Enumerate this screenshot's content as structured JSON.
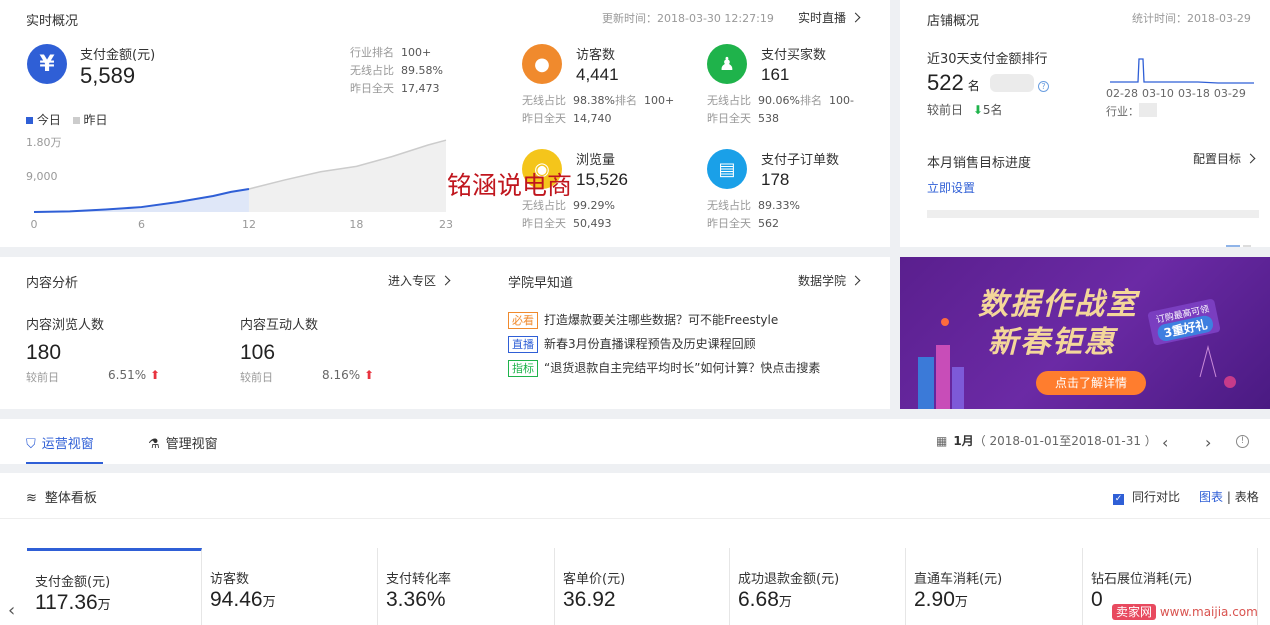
{
  "realtime": {
    "title": "实时概况",
    "update_time": "更新时间：2018-03-30 12:27:19",
    "live_link": "实时直播",
    "pay": {
      "label": "支付金额(元)",
      "value": "5,589",
      "rows": [
        {
          "k": "行业排名",
          "v": "100+"
        },
        {
          "k": "无线占比",
          "v": "89.58%"
        },
        {
          "k": "昨日全天",
          "v": "17,473"
        }
      ]
    },
    "legend_today": "今日",
    "legend_yesterday": "昨日",
    "chart": {
      "type": "area",
      "x_ticks": [
        "0",
        "6",
        "12",
        "18",
        "23"
      ],
      "y_ticks": [
        "1.80万",
        "9,000"
      ],
      "today_color": "#2f5fd6",
      "yesterday_color": "#cccccc",
      "series": [
        {
          "name": "今日",
          "x": [
            0,
            2,
            4,
            6,
            8,
            10,
            11,
            12
          ],
          "values": [
            0,
            150,
            600,
            1200,
            2400,
            3900,
            4900,
            5589
          ]
        },
        {
          "name": "昨日",
          "x": [
            0,
            2,
            4,
            6,
            8,
            10,
            12,
            14,
            16,
            18,
            20,
            22,
            23
          ],
          "values": [
            0,
            150,
            600,
            1200,
            2400,
            3900,
            5600,
            7800,
            9800,
            11100,
            13500,
            16300,
            17473
          ]
        }
      ],
      "ylim": [
        0,
        18000
      ]
    },
    "metrics": [
      {
        "name": "访客数",
        "value": "4,441",
        "r1k": "无线占比",
        "r1v": "98.38%",
        "r1k2": "排名",
        "r1v2": "100+",
        "r2k": "昨日全天",
        "r2v": "14,740",
        "icon": "footprint-icon",
        "color": "#f08a2d"
      },
      {
        "name": "支付买家数",
        "value": "161",
        "r1k": "无线占比",
        "r1v": "90.06%",
        "r1k2": "排名",
        "r1v2": "100-",
        "r2k": "昨日全天",
        "r2v": "538",
        "icon": "users-icon",
        "color": "#1fb34b"
      },
      {
        "name": "浏览量",
        "value": "15,526",
        "r1k": "无线占比",
        "r1v": "99.29%",
        "r2k": "昨日全天",
        "r2v": "50,493",
        "icon": "eye-icon",
        "color": "#f4c51b"
      },
      {
        "name": "支付子订单数",
        "value": "178",
        "r1k": "无线占比",
        "r1v": "89.33%",
        "r2k": "昨日全天",
        "r2v": "562",
        "icon": "clipboard-icon",
        "color": "#1aa0e8"
      }
    ],
    "watermark": "铭涵说电商"
  },
  "store": {
    "title": "店铺概况",
    "stat_time": "统计时间：2018-03-29",
    "rank_label": "近30天支付金额排行",
    "rank_value": "522",
    "rank_unit": "名",
    "compare_label": "较前日",
    "compare_value": "5名",
    "industry_label": "行业：",
    "mini_dates": [
      "02-28",
      "03-10",
      "03-18",
      "03-29"
    ],
    "target_title": "本月销售目标进度",
    "target_config": "配置目标",
    "target_set": "立即设置"
  },
  "content": {
    "title": "内容分析",
    "enter": "进入专区",
    "browse_label": "内容浏览人数",
    "browse_value": "180",
    "browse_cmp": "较前日",
    "browse_pct": "6.51%",
    "interact_label": "内容互动人数",
    "interact_value": "106",
    "interact_cmp": "较前日",
    "interact_pct": "8.16%"
  },
  "academy": {
    "title": "学院早知道",
    "link": "数据学院",
    "items": [
      {
        "tag": "必看",
        "tag_color": "#f08a2d",
        "text": "打造爆款要关注哪些数据？可不能Freestyle"
      },
      {
        "tag": "直播",
        "tag_color": "#2f5fd6",
        "text": "新春3月份直播课程预告及历史课程回顾"
      },
      {
        "tag": "指标",
        "tag_color": "#1fb34b",
        "text": "“退货退款自主完结平均时长”如何计算？快点击搜素"
      }
    ]
  },
  "banner": {
    "line1": "数据作战室",
    "line2": "新春钜惠",
    "badge_top": "订购最高可领",
    "badge": "3重好礼",
    "button": "点击了解详情"
  },
  "tabs": {
    "ops": "运营视窗",
    "mgmt": "管理视窗",
    "date_bold": "1月",
    "date_range": "（ 2018-01-01至2018-01-31 ）"
  },
  "board": {
    "title": "整体看板",
    "compare": "同行对比",
    "view_chart": "图表",
    "view_table": "表格",
    "kpis": [
      {
        "label": "支付金额(元)",
        "value": "117.36",
        "unit": "万"
      },
      {
        "label": "访客数",
        "value": "94.46",
        "unit": "万"
      },
      {
        "label": "支付转化率",
        "value": "3.36%",
        "unit": ""
      },
      {
        "label": "客单价(元)",
        "value": "36.92",
        "unit": ""
      },
      {
        "label": "成功退款金额(元)",
        "value": "6.68",
        "unit": "万"
      },
      {
        "label": "直通车消耗(元)",
        "value": "2.90",
        "unit": "万"
      },
      {
        "label": "钻石展位消耗(元)",
        "value": "0",
        "unit": ""
      }
    ]
  },
  "footer_watermark": {
    "brand": "卖家网",
    "url": "www.maijia.com"
  }
}
